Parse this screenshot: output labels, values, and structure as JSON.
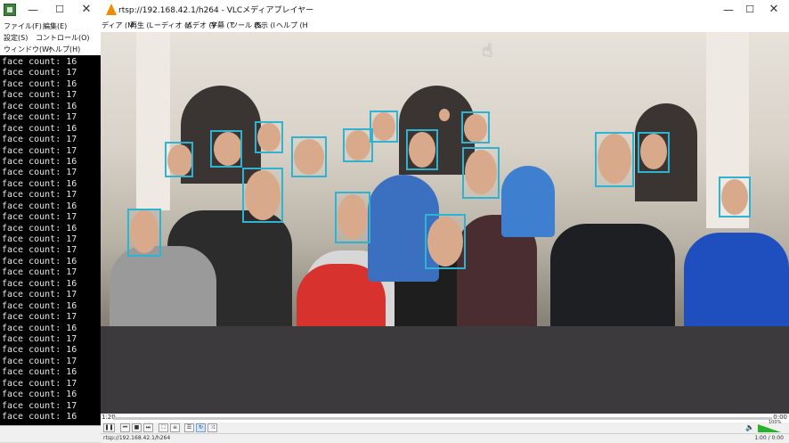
{
  "left_window": {
    "menu": [
      "ファイル(F)",
      "編集(E)",
      "設定(S)",
      "コントロール(O)",
      "ウィンドウ(W)",
      "ヘルプ(H)"
    ],
    "console_lines": [
      "face count: 16",
      "face count: 17",
      "face count: 16",
      "face count: 17",
      "face count: 16",
      "face count: 17",
      "face count: 16",
      "face count: 17",
      "face count: 17",
      "face count: 16",
      "face count: 17",
      "face count: 16",
      "face count: 17",
      "face count: 16",
      "face count: 17",
      "face count: 16",
      "face count: 17",
      "face count: 17",
      "face count: 16",
      "face count: 17",
      "face count: 16",
      "face count: 17",
      "face count: 16",
      "face count: 17",
      "face count: 16",
      "face count: 17",
      "face count: 16",
      "face count: 17",
      "face count: 16",
      "face count: 17",
      "face count: 16",
      "face count: 17",
      "face count: 16"
    ]
  },
  "vlc": {
    "title": "rtsp://192.168.42.1/h264 - VLCメディアプレイヤー",
    "menu": [
      "ディア (M",
      "再生 (L",
      "ーディオ (A",
      "ビデオ (V",
      "字幕 (T",
      "ツール (S",
      "表示 (I",
      "ヘルプ (H"
    ],
    "time_elapsed": "1:20",
    "time_total": "0:00",
    "volume": "100%",
    "status_url": "rtsp://192.168.42.1/h264",
    "status_time": "1:00 / 0:00"
  },
  "face_count_boxes": 17,
  "colors": {
    "face_box": "#2fb3d3",
    "console_bg": "#000000",
    "console_text": "#e8e8e8"
  }
}
